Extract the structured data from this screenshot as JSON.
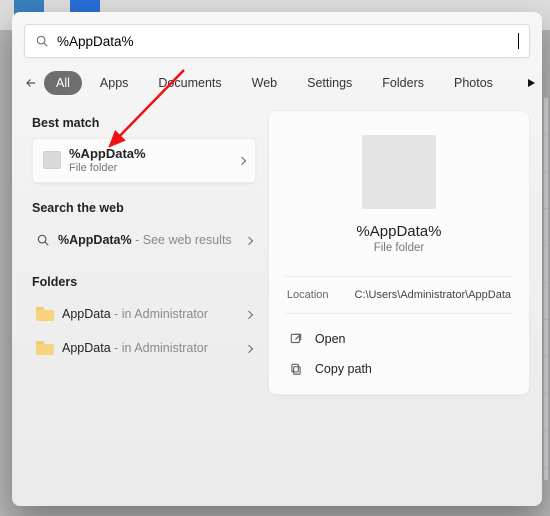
{
  "search": {
    "query": "%AppData%"
  },
  "tabs": {
    "back_aria": "Back",
    "items": [
      "All",
      "Apps",
      "Documents",
      "Web",
      "Settings",
      "Folders",
      "Photos"
    ]
  },
  "sections": {
    "best_match": "Best match",
    "search_web": "Search the web",
    "folders": "Folders"
  },
  "best_match": {
    "title": "%AppData%",
    "subtitle": "File folder"
  },
  "web_result": {
    "query": "%AppData%",
    "suffix": " - See web results"
  },
  "folder_results": [
    {
      "name": "AppData",
      "suffix": " - in Administrator"
    },
    {
      "name": "AppData",
      "suffix": " - in Administrator"
    }
  ],
  "preview": {
    "title": "%AppData%",
    "subtitle": "File folder",
    "location_label": "Location",
    "location_value": "C:\\Users\\Administrator\\AppData",
    "actions": {
      "open": "Open",
      "copy_path": "Copy path"
    }
  }
}
